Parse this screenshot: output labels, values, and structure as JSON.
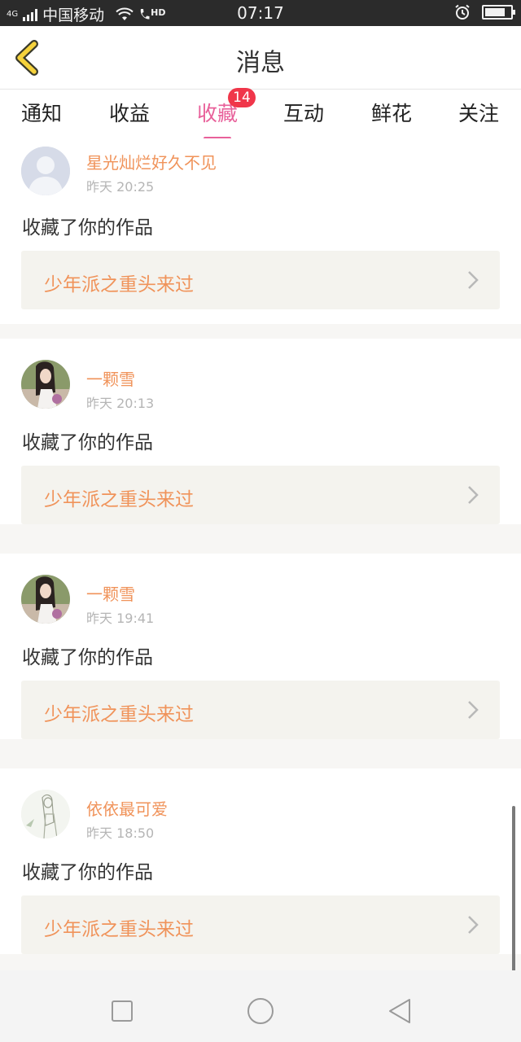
{
  "status_bar": {
    "network": "4G",
    "carrier": "中国移动",
    "hd": "HD",
    "time": "07:17",
    "battery_level": 0.8
  },
  "header": {
    "title": "消息",
    "back_icon": "chevron-left-icon"
  },
  "tabs": [
    {
      "label": "通知"
    },
    {
      "label": "收益"
    },
    {
      "label": "收藏",
      "active": true,
      "badge": "14"
    },
    {
      "label": "互动"
    },
    {
      "label": "鲜花"
    },
    {
      "label": "关注"
    }
  ],
  "items": [
    {
      "name": "星光灿烂好久不见",
      "time": "昨天 20:25",
      "action": "收藏了你的作品",
      "work": "少年派之重头来过"
    },
    {
      "name": "一颗雪",
      "time": "昨天 20:13",
      "action": "收藏了你的作品",
      "work": "少年派之重头来过"
    },
    {
      "name": "一颗雪",
      "time": "昨天 19:41",
      "action": "收藏了你的作品",
      "work": "少年派之重头来过"
    },
    {
      "name": "依依最可爱",
      "time": "昨天 18:50",
      "action": "收藏了你的作品",
      "work": "少年派之重头来过"
    }
  ],
  "colors": {
    "accent": "#e8609a",
    "name": "#f0935a",
    "badge": "#f0364a",
    "back_icon": "#f5d23c"
  },
  "navbar": {
    "icons": [
      "recents-square-icon",
      "home-circle-icon",
      "back-triangle-icon"
    ]
  }
}
